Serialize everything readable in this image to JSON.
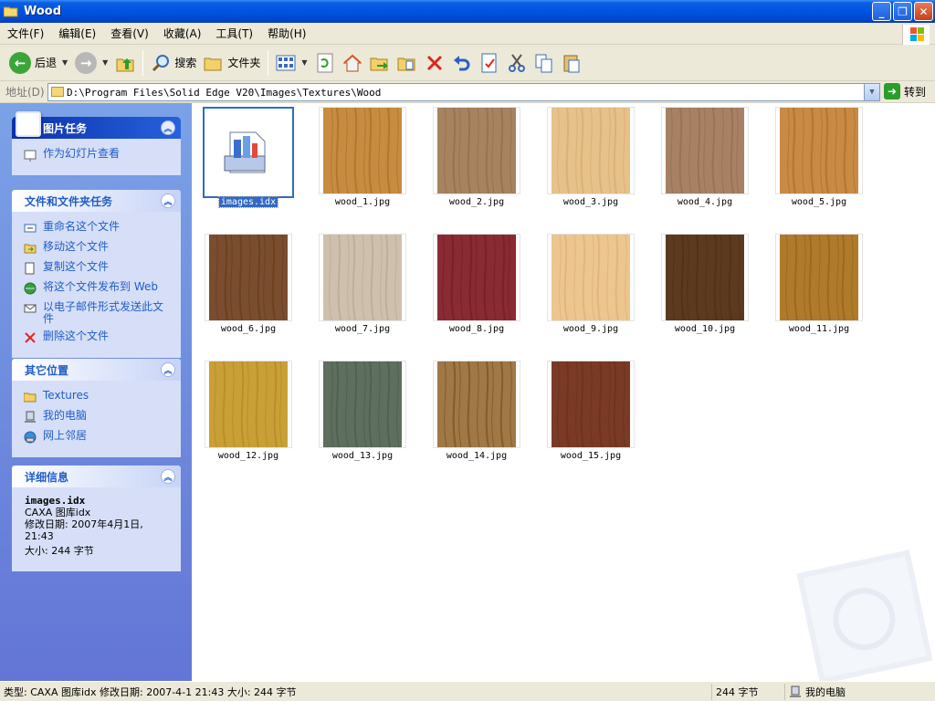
{
  "window": {
    "title": "Wood"
  },
  "menu": [
    "文件(F)",
    "编辑(E)",
    "查看(V)",
    "收藏(A)",
    "工具(T)",
    "帮助(H)"
  ],
  "toolbar": {
    "back_label": "后退",
    "search_label": "搜索",
    "folders_label": "文件夹"
  },
  "address": {
    "label": "地址(D)",
    "path": "D:\\Program Files\\Solid Edge V20\\Images\\Textures\\Wood",
    "go_label": "转到"
  },
  "panels": {
    "picture_tasks": {
      "title": "图片任务",
      "items": [
        "作为幻灯片查看"
      ]
    },
    "file_tasks": {
      "title": "文件和文件夹任务",
      "items": [
        "重命名这个文件",
        "移动这个文件",
        "复制这个文件",
        "将这个文件发布到 Web",
        "以电子邮件形式发送此文件",
        "删除这个文件"
      ]
    },
    "other_places": {
      "title": "其它位置",
      "items": [
        "Textures",
        "我的电脑",
        "网上邻居"
      ]
    },
    "details": {
      "title": "详细信息",
      "filename": "images.idx",
      "type": "CAXA 图库idx",
      "modified": "修改日期: 2007年4月1日, 21:43",
      "size": "大小: 244 字节"
    }
  },
  "files": [
    {
      "name": "images.idx",
      "kind": "idx",
      "selected": true
    },
    {
      "name": "wood_1.jpg",
      "kind": "jpg",
      "color": "#c78c3f",
      "grain": "#a5692a"
    },
    {
      "name": "wood_2.jpg",
      "kind": "jpg",
      "color": "#a88360",
      "grain": "#8a6a4b"
    },
    {
      "name": "wood_3.jpg",
      "kind": "jpg",
      "color": "#e6c189",
      "grain": "#d2a86a"
    },
    {
      "name": "wood_4.jpg",
      "kind": "jpg",
      "color": "#a88164",
      "grain": "#8b6a50"
    },
    {
      "name": "wood_5.jpg",
      "kind": "jpg",
      "color": "#c98a45",
      "grain": "#a8692c"
    },
    {
      "name": "wood_6.jpg",
      "kind": "jpg",
      "color": "#7a4d2e",
      "grain": "#5e3a22"
    },
    {
      "name": "wood_7.jpg",
      "kind": "jpg",
      "color": "#cfc0ad",
      "grain": "#b4a28d"
    },
    {
      "name": "wood_8.jpg",
      "kind": "jpg",
      "color": "#8a2a33",
      "grain": "#6b1c25"
    },
    {
      "name": "wood_9.jpg",
      "kind": "jpg",
      "color": "#edc58f",
      "grain": "#d8ab72"
    },
    {
      "name": "wood_10.jpg",
      "kind": "jpg",
      "color": "#5c3a1f",
      "grain": "#472c15"
    },
    {
      "name": "wood_11.jpg",
      "kind": "jpg",
      "color": "#b07a2b",
      "grain": "#8e5e1c"
    },
    {
      "name": "wood_12.jpg",
      "kind": "jpg",
      "color": "#c9a036",
      "grain": "#ad8424"
    },
    {
      "name": "wood_13.jpg",
      "kind": "jpg",
      "color": "#5e6e5f",
      "grain": "#485649"
    },
    {
      "name": "wood_14.jpg",
      "kind": "jpg",
      "color": "#a07846",
      "grain": "#6b4a22"
    },
    {
      "name": "wood_15.jpg",
      "kind": "jpg",
      "color": "#7a3a26",
      "grain": "#62301d"
    }
  ],
  "status": {
    "info": "类型: CAXA 图库idx 修改日期: 2007-4-1 21:43 大小: 244 字节",
    "size": "244 字节",
    "location": "我的电脑"
  }
}
